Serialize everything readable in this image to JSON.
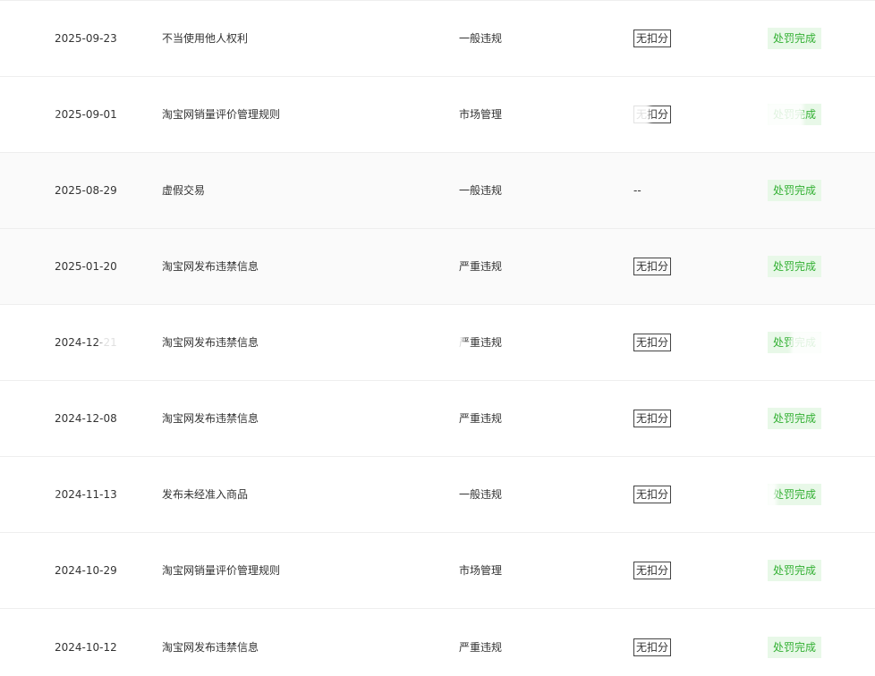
{
  "rows": [
    {
      "date": "2025-09-23",
      "rule": "不当使用他人权利",
      "type": "一般违规",
      "points": "无扣分",
      "status": "处罚完成"
    },
    {
      "date": "2025-09-01",
      "rule": "淘宝网销量评价管理规则",
      "type": "市场管理",
      "points": "无扣分",
      "status": "处罚完成"
    },
    {
      "date": "2025-08-29",
      "rule": "虚假交易",
      "type": "一般违规",
      "points": "--",
      "status": "处罚完成"
    },
    {
      "date": "2025-01-20",
      "rule": "淘宝网发布违禁信息",
      "type": "严重违规",
      "points": "无扣分",
      "status": "处罚完成"
    },
    {
      "date": "2024-12-21",
      "rule": "淘宝网发布违禁信息",
      "type": "严重违规",
      "points": "无扣分",
      "status": "处罚完成"
    },
    {
      "date": "2024-12-08",
      "rule": "淘宝网发布违禁信息",
      "type": "严重违规",
      "points": "无扣分",
      "status": "处罚完成"
    },
    {
      "date": "2024-11-13",
      "rule": "发布未经准入商品",
      "type": "一般违规",
      "points": "无扣分",
      "status": "处罚完成"
    },
    {
      "date": "2024-10-29",
      "rule": "淘宝网销量评价管理规则",
      "type": "市场管理",
      "points": "无扣分",
      "status": "处罚完成"
    },
    {
      "date": "2024-10-12",
      "rule": "淘宝网发布违禁信息",
      "type": "严重违规",
      "points": "无扣分",
      "status": "处罚完成"
    }
  ],
  "colors": {
    "status_text": "#33b033",
    "status_bg": "#e8f8e8",
    "row_border": "#eeeeee",
    "row_alt_bg": "#fafafa"
  }
}
